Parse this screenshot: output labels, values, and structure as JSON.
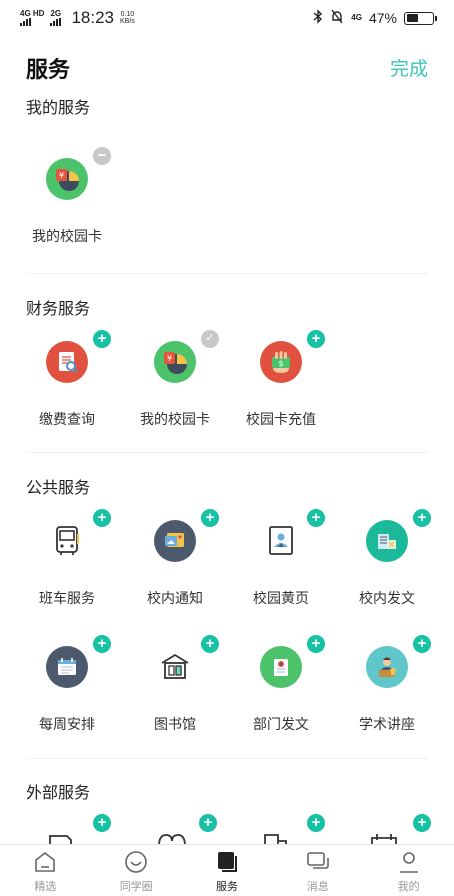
{
  "status_bar": {
    "network1": "4G HD",
    "network2": "2G",
    "time": "18:23",
    "speed_value": "0.10",
    "speed_unit": "KB/s",
    "network3": "4G",
    "battery": "47%",
    "battery_level": 0.47
  },
  "header": {
    "title": "服务",
    "done": "完成"
  },
  "sections": {
    "my": {
      "title": "我的服务",
      "items": [
        {
          "label": "我的校园卡",
          "icon": "campus-card-icon",
          "badge": "−"
        }
      ]
    },
    "finance": {
      "title": "财务服务",
      "items": [
        {
          "label": "缴费查询",
          "icon": "payment-query-icon",
          "badge": "+"
        },
        {
          "label": "我的校园卡",
          "icon": "campus-card-icon",
          "badge": "✓"
        },
        {
          "label": "校园卡充值",
          "icon": "card-recharge-icon",
          "badge": "+"
        }
      ]
    },
    "public": {
      "title": "公共服务",
      "items": [
        {
          "label": "班车服务",
          "icon": "shuttle-bus-icon",
          "badge": "+"
        },
        {
          "label": "校内通知",
          "icon": "campus-notice-icon",
          "badge": "+"
        },
        {
          "label": "校园黄页",
          "icon": "yellow-pages-icon",
          "badge": "+"
        },
        {
          "label": "校内发文",
          "icon": "campus-document-icon",
          "badge": "+"
        },
        {
          "label": "每周安排",
          "icon": "weekly-schedule-icon",
          "badge": "+"
        },
        {
          "label": "图书馆",
          "icon": "library-icon",
          "badge": "+"
        },
        {
          "label": "部门发文",
          "icon": "department-document-icon",
          "badge": "+"
        },
        {
          "label": "学术讲座",
          "icon": "academic-lecture-icon",
          "badge": "+"
        }
      ]
    },
    "external": {
      "title": "外部服务",
      "badge": "+"
    }
  },
  "tabs": [
    {
      "label": "精选",
      "icon": "home-icon"
    },
    {
      "label": "同学圈",
      "icon": "smile-icon"
    },
    {
      "label": "服务",
      "icon": "service-icon",
      "active": true
    },
    {
      "label": "消息",
      "icon": "message-icon"
    },
    {
      "label": "我的",
      "icon": "profile-icon"
    }
  ],
  "colors": {
    "accent": "#16c2a3",
    "done": "#3cc6b4",
    "card_green": "#4cc36a",
    "red": "#e0523f",
    "dark_slate": "#4d5a6e"
  }
}
